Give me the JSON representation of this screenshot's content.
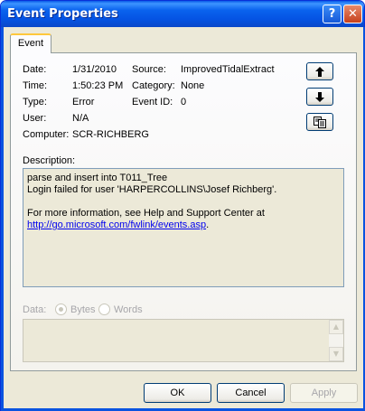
{
  "window": {
    "title": "Event Properties",
    "help_glyph": "?",
    "close_glyph": "✕"
  },
  "tabs": [
    {
      "label": "Event"
    }
  ],
  "details": {
    "date_label": "Date:",
    "date": "1/31/2010",
    "time_label": "Time:",
    "time": "1:50:23 PM",
    "type_label": "Type:",
    "type": "Error",
    "user_label": "User:",
    "user": "N/A",
    "computer_label": "Computer:",
    "computer": "SCR-RICHBERG",
    "source_label": "Source:",
    "source": "ImprovedTidalExtract",
    "category_label": "Category:",
    "category": "None",
    "event_id_label": "Event ID:",
    "event_id": "0"
  },
  "description": {
    "label": "Description:",
    "lines": [
      "parse and insert into T011_Tree",
      "Login failed for user 'HARPERCOLLINS\\Josef Richberg'.",
      "",
      "For more information, see Help and Support Center at"
    ],
    "link": "http://go.microsoft.com/fwlink/events.asp",
    "link_suffix": "."
  },
  "data": {
    "label": "Data:",
    "options": [
      {
        "label": "Bytes",
        "selected": true
      },
      {
        "label": "Words",
        "selected": false
      }
    ]
  },
  "buttons": {
    "ok": "OK",
    "cancel": "Cancel",
    "apply": "Apply"
  },
  "icons": {
    "previous": "up-arrow-icon",
    "next": "down-arrow-icon",
    "copy": "copy-icon"
  },
  "colors": {
    "titlebar": "#0a5ae8",
    "link": "#0000ee",
    "disabled_text": "#a7a6aa"
  }
}
